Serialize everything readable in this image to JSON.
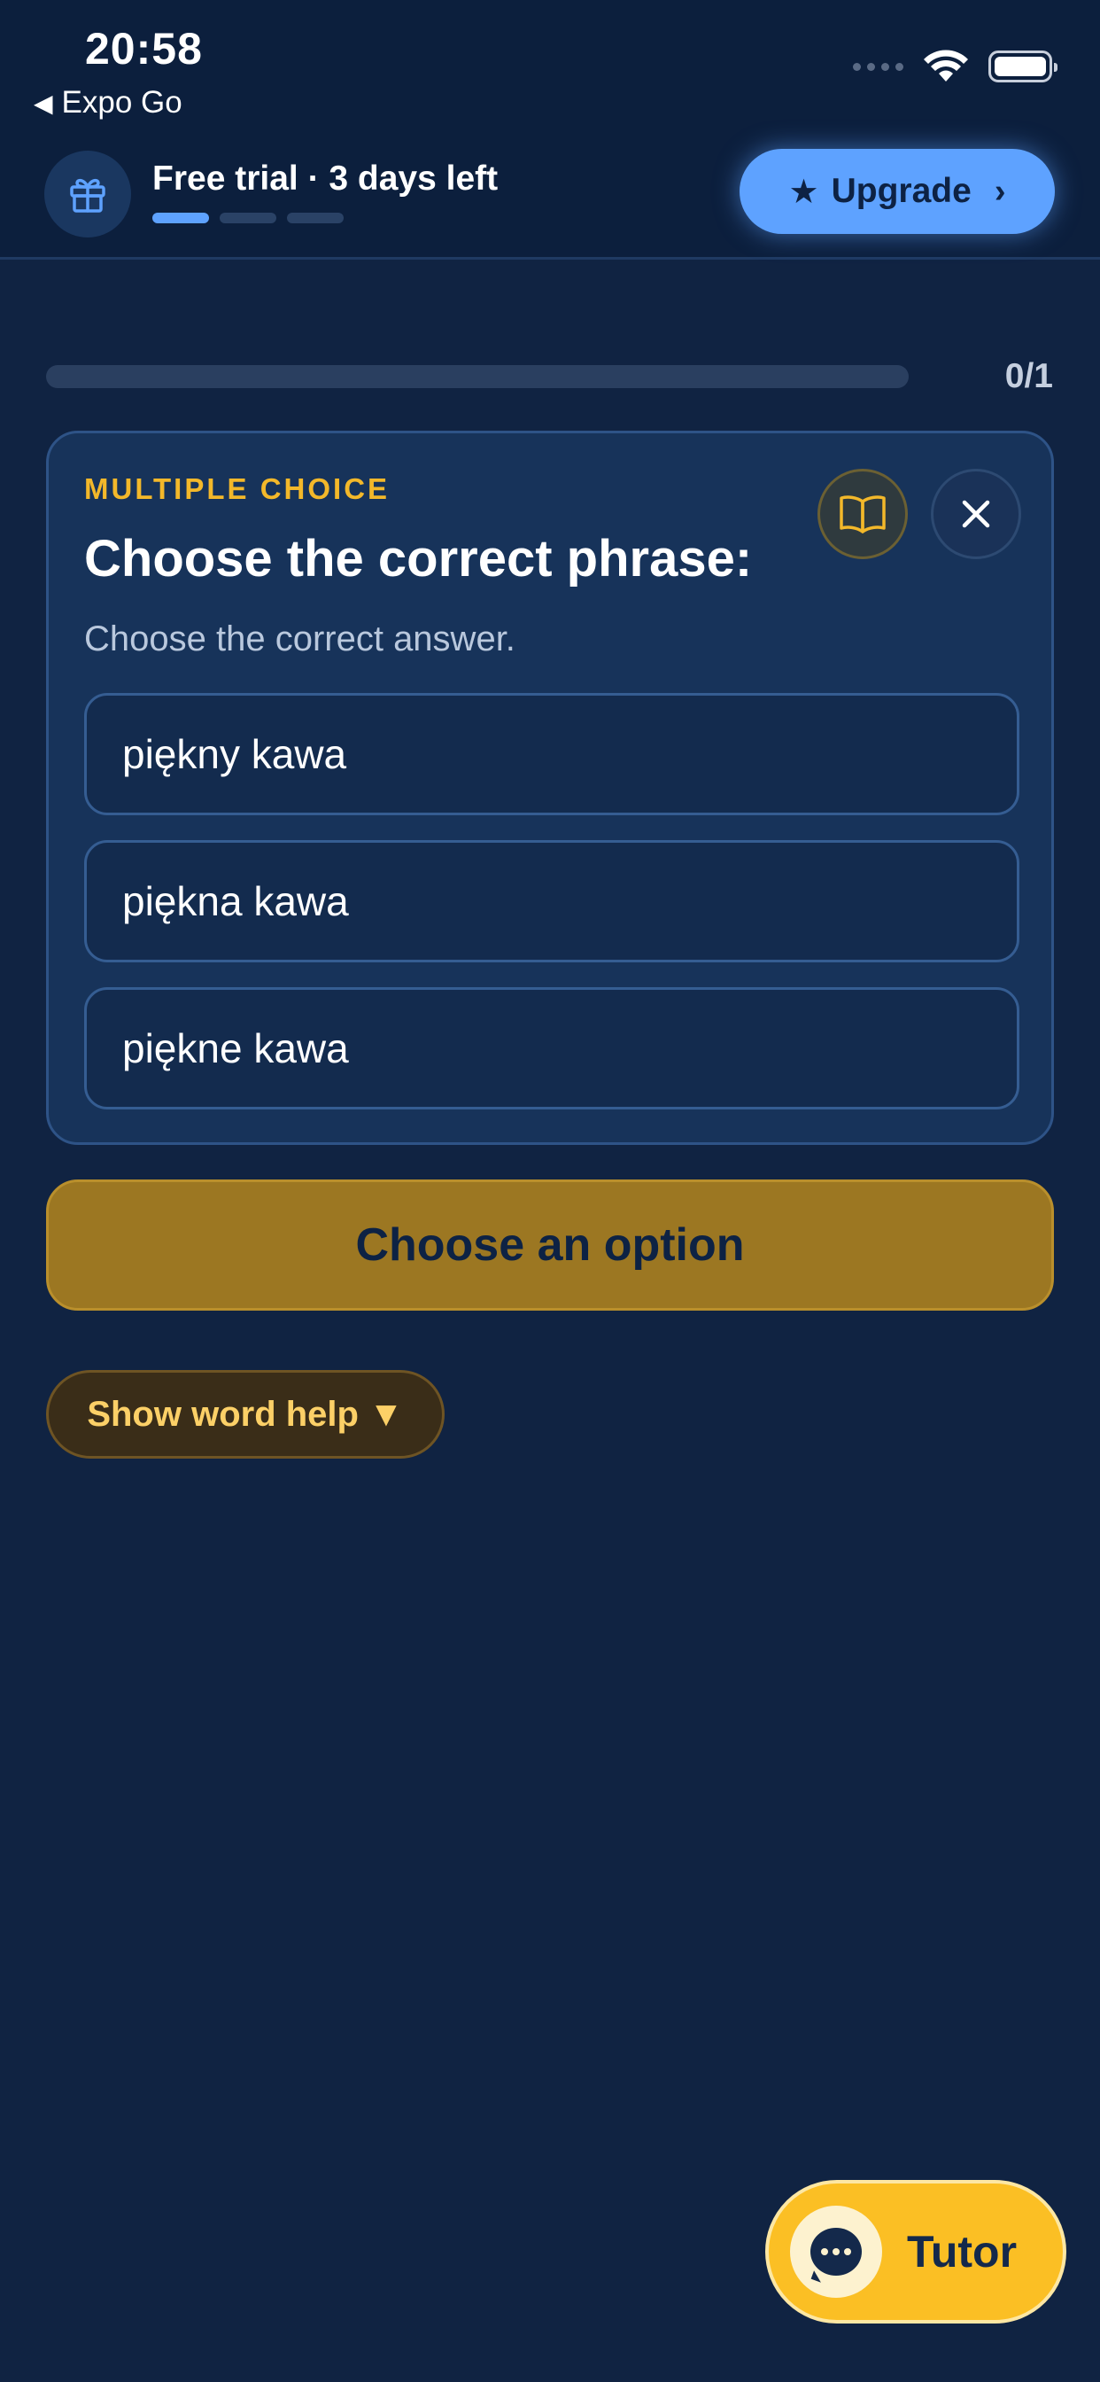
{
  "status_bar": {
    "time": "20:58",
    "back_label": "Expo Go",
    "icons": [
      "signal-dots-icon",
      "wifi-icon",
      "battery-icon"
    ]
  },
  "trial_banner": {
    "text": "Free trial · 3 days left",
    "icon": "gift-icon",
    "progress_steps_total": 3,
    "progress_steps_done": 1
  },
  "upgrade": {
    "label": "Upgrade",
    "star": "★",
    "chevron": "›",
    "color": "#5ea2ff"
  },
  "lesson_progress": {
    "count": "0/1",
    "fraction": 0
  },
  "card": {
    "kicker": "MULTIPLE CHOICE",
    "title": "Choose the correct phrase:",
    "subtitle": "Choose the correct answer.",
    "options": [
      "piękny kawa",
      "piękna kawa",
      "piękne kawa"
    ]
  },
  "actions": {
    "choose_label": "Choose an option",
    "word_help_label": "Show word help ▼",
    "tutor_label": "Tutor"
  },
  "colors": {
    "background": "#102342",
    "accent_yellow": "#fbbf24",
    "kicker": "#f3b82a"
  }
}
